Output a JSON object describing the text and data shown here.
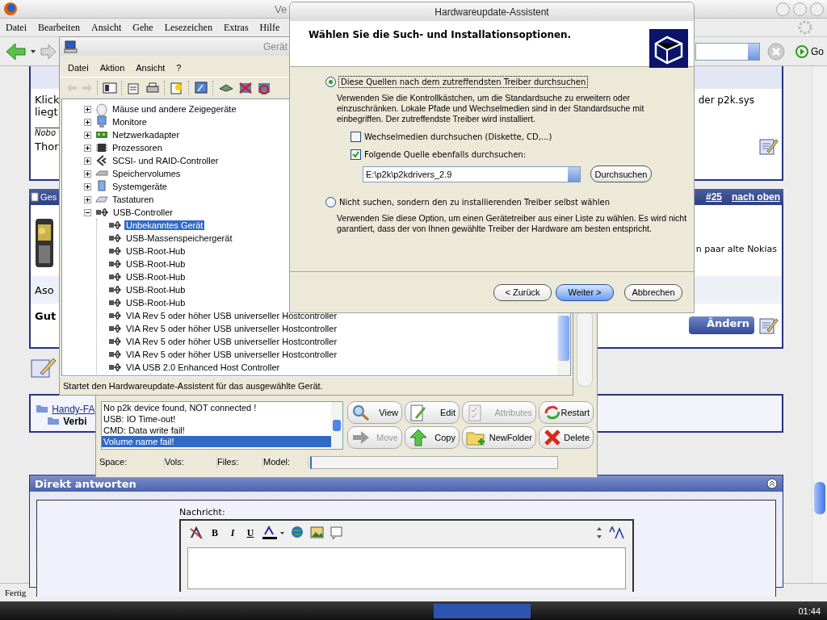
{
  "browser": {
    "title": "Ve",
    "menu": [
      "Datei",
      "Bearbeiten",
      "Ansicht",
      "Gehe",
      "Lesezeichen",
      "Extras",
      "Hilfe"
    ],
    "go_label": "Go",
    "status": "Fertig"
  },
  "forum": {
    "post_1": {
      "lines": [
        "Klick",
        "liegt"
      ],
      "right_text": "der p2k.sys",
      "signature": "Nobo",
      "signature_name": "Thor"
    },
    "post_2": {
      "header": "Ges",
      "number": "#25",
      "top_link": "nach oben",
      "right_text": "n paar alte Nokias",
      "lines": [
        "Aso",
        "Gut"
      ],
      "edit_button": "Ändern"
    },
    "breadcrumb": [
      "Handy-FA",
      "Verbi"
    ],
    "reply": {
      "title": "Direkt antworten",
      "label": "Nachricht:",
      "format_buttons": [
        "B",
        "I",
        "U"
      ]
    }
  },
  "p2k_tool": {
    "log": [
      {
        "text": "No p2k device found, NOT connected !",
        "selected": false
      },
      {
        "text": "USB: IO Time-out!",
        "selected": false
      },
      {
        "text": "CMD: Data write fail!",
        "selected": false
      },
      {
        "text": "Volume name fail!",
        "selected": true
      }
    ],
    "buttons": [
      {
        "label": "View",
        "disabled": false
      },
      {
        "label": "Edit",
        "disabled": false
      },
      {
        "label": "Attributes",
        "disabled": true
      },
      {
        "label": "Restart",
        "disabled": false
      },
      {
        "label": "Move",
        "disabled": true
      },
      {
        "label": "Copy",
        "disabled": false
      },
      {
        "label": "NewFolder",
        "disabled": false
      },
      {
        "label": "Delete",
        "disabled": false
      }
    ],
    "status_fields": [
      "Space:",
      "Vols:",
      "Files:",
      "Model:"
    ]
  },
  "device_manager": {
    "title": "Gerät",
    "menu": [
      "Datei",
      "Aktion",
      "Ansicht",
      "?"
    ],
    "tree": [
      {
        "label": "Mäuse und andere Zeigegeräte",
        "expanded": false
      },
      {
        "label": "Monitore",
        "expanded": false
      },
      {
        "label": "Netzwerkadapter",
        "expanded": false
      },
      {
        "label": "Prozessoren",
        "expanded": false
      },
      {
        "label": "SCSI- und RAID-Controller",
        "expanded": false
      },
      {
        "label": "Speichervolumes",
        "expanded": false
      },
      {
        "label": "Systemgeräte",
        "expanded": false
      },
      {
        "label": "Tastaturen",
        "expanded": false
      },
      {
        "label": "USB-Controller",
        "expanded": true,
        "children": [
          {
            "label": "Unbekanntes Gerät",
            "selected": true
          },
          {
            "label": "USB-Massenspeichergerät",
            "selected": false
          },
          {
            "label": "USB-Root-Hub",
            "selected": false
          },
          {
            "label": "USB-Root-Hub",
            "selected": false
          },
          {
            "label": "USB-Root-Hub",
            "selected": false
          },
          {
            "label": "USB-Root-Hub",
            "selected": false
          },
          {
            "label": "USB-Root-Hub",
            "selected": false
          },
          {
            "label": "VIA Rev 5 oder höher USB universeller Hostcontroller",
            "selected": false
          },
          {
            "label": "VIA Rev 5 oder höher USB universeller Hostcontroller",
            "selected": false
          },
          {
            "label": "VIA Rev 5 oder höher USB universeller Hostcontroller",
            "selected": false
          },
          {
            "label": "VIA Rev 5 oder höher USB universeller Hostcontroller",
            "selected": false
          },
          {
            "label": "VIA USB 2.0 Enhanced Host Controller",
            "selected": false
          }
        ]
      }
    ],
    "status": "Startet den Hardwareupdate-Assistent für das ausgewählte Gerät."
  },
  "wizard": {
    "title": "Hardwareupdate-Assistent",
    "heading": "Wählen Sie die Such- und Installationsoptionen.",
    "options": [
      {
        "label": "Diese Quellen nach dem zutreffendsten Treiber durchsuchen",
        "selected": true,
        "description": "Verwenden Sie die Kontrollkästchen, um die Standardsuche zu erweitern oder einzuschränken. Lokale Pfade und Wechselmedien sind in der Standardsuche mit einbegriffen. Der zutreffendste Treiber wird installiert."
      },
      {
        "label": "Nicht suchen, sondern den zu installierenden Treiber selbst wählen",
        "selected": false,
        "description": "Verwenden Sie diese Option, um einen Gerätetreiber aus einer Liste zu wählen. Es wird nicht garantiert, dass der von Ihnen gewählte Treiber der Hardware am besten entspricht."
      }
    ],
    "checkboxes": [
      {
        "label": "Wechselmedien durchsuchen (Diskette, CD,...)",
        "checked": false
      },
      {
        "label": "Folgende Quelle ebenfalls durchsuchen:",
        "checked": true
      }
    ],
    "path": "E:\\p2k\\p2kdrivers_2.9",
    "browse_button": "Durchsuchen",
    "buttons": [
      {
        "label": "< Zurück",
        "default": false
      },
      {
        "label": "Weiter >",
        "default": true
      },
      {
        "label": "Abbrechen",
        "default": false
      }
    ]
  },
  "taskbar": {
    "clock": "01:44"
  }
}
